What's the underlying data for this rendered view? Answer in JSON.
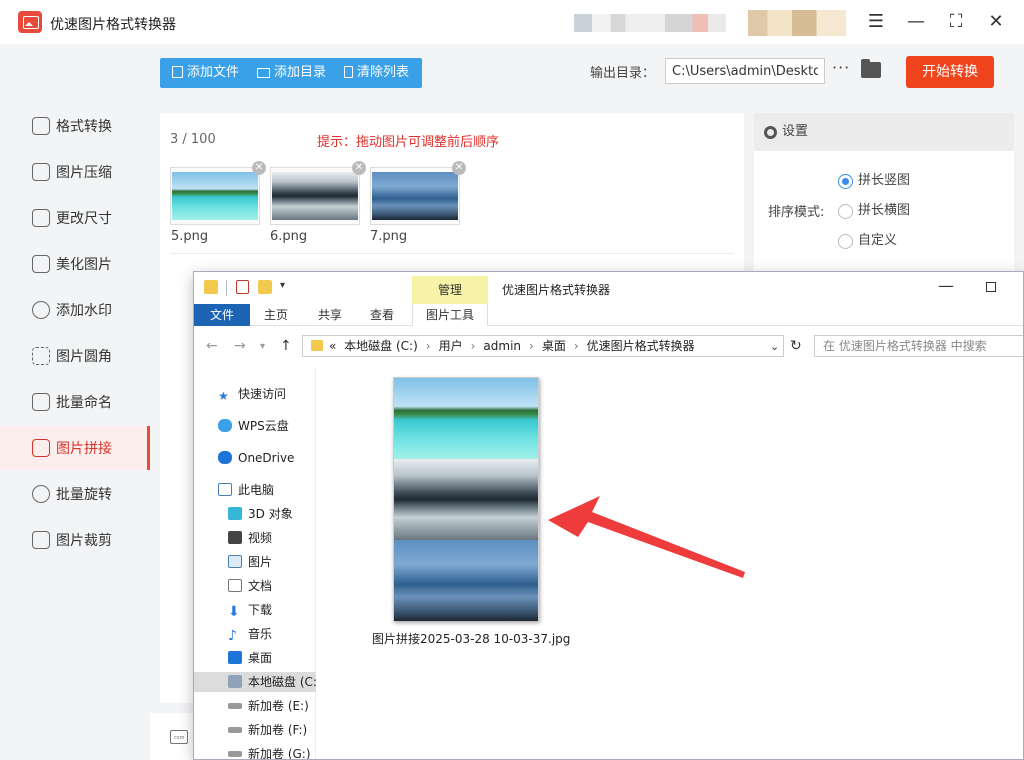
{
  "app": {
    "title": "优速图片格式转换器"
  },
  "sidebar": {
    "items": [
      {
        "label": "格式转换",
        "icon": "convert-icon"
      },
      {
        "label": "图片压缩",
        "icon": "compress-icon"
      },
      {
        "label": "更改尺寸",
        "icon": "resize-icon"
      },
      {
        "label": "美化图片",
        "icon": "beautify-icon"
      },
      {
        "label": "添加水印",
        "icon": "watermark-icon"
      },
      {
        "label": "图片圆角",
        "icon": "rounded-corner-icon"
      },
      {
        "label": "批量命名",
        "icon": "rename-icon"
      },
      {
        "label": "图片拼接",
        "icon": "stitch-icon",
        "active": true
      },
      {
        "label": "批量旋转",
        "icon": "rotate-icon"
      },
      {
        "label": "图片裁剪",
        "icon": "crop-icon"
      }
    ]
  },
  "toolbar": {
    "add_file": "添加文件",
    "add_folder": "添加目录",
    "clear_list": "清除列表",
    "output_label": "输出目录：",
    "output_path": "C:\\Users\\admin\\Desktop",
    "more": "···",
    "start": "开始转换"
  },
  "filelist": {
    "count": "3 / 100",
    "hint": "提示：拖动图片可调整前后顺序",
    "files": [
      {
        "name": "5.png"
      },
      {
        "name": "6.png"
      },
      {
        "name": "7.png"
      }
    ]
  },
  "settings": {
    "title": "设置",
    "sort_label": "排序模式:",
    "options": [
      "拼长竖图",
      "拼长横图",
      "自定义"
    ],
    "selected": 0
  },
  "explorer": {
    "manage_tab": "管理",
    "title": "优速图片格式转换器",
    "ribbon": [
      "文件",
      "主页",
      "共享",
      "查看",
      "图片工具"
    ],
    "breadcrumb": [
      "«",
      "本地磁盘 (C:)",
      "用户",
      "admin",
      "桌面",
      "优速图片格式转换器"
    ],
    "search_placeholder": "在 优速图片格式转换器 中搜索",
    "tree": [
      {
        "label": "快速访问",
        "indent": 0
      },
      {
        "label": "WPS云盘",
        "indent": 0
      },
      {
        "label": "OneDrive",
        "indent": 0
      },
      {
        "label": "此电脑",
        "indent": 0
      },
      {
        "label": "3D 对象",
        "indent": 1
      },
      {
        "label": "视频",
        "indent": 1
      },
      {
        "label": "图片",
        "indent": 1
      },
      {
        "label": "文档",
        "indent": 1
      },
      {
        "label": "下载",
        "indent": 1
      },
      {
        "label": "音乐",
        "indent": 1
      },
      {
        "label": "桌面",
        "indent": 1
      },
      {
        "label": "本地磁盘 (C:",
        "indent": 1,
        "selected": true
      },
      {
        "label": "新加卷 (E:)",
        "indent": 1
      },
      {
        "label": "新加卷 (F:)",
        "indent": 1
      },
      {
        "label": "新加卷 (G:)",
        "indent": 1
      }
    ],
    "output_file": "图片拼接2025-03-28 10-03-37.jpg"
  },
  "colors": {
    "accent_red": "#f0441c",
    "toolbar_blue": "#3aa0e8",
    "hint_red": "#e0302a",
    "arrow_red": "#ee3b3b"
  }
}
